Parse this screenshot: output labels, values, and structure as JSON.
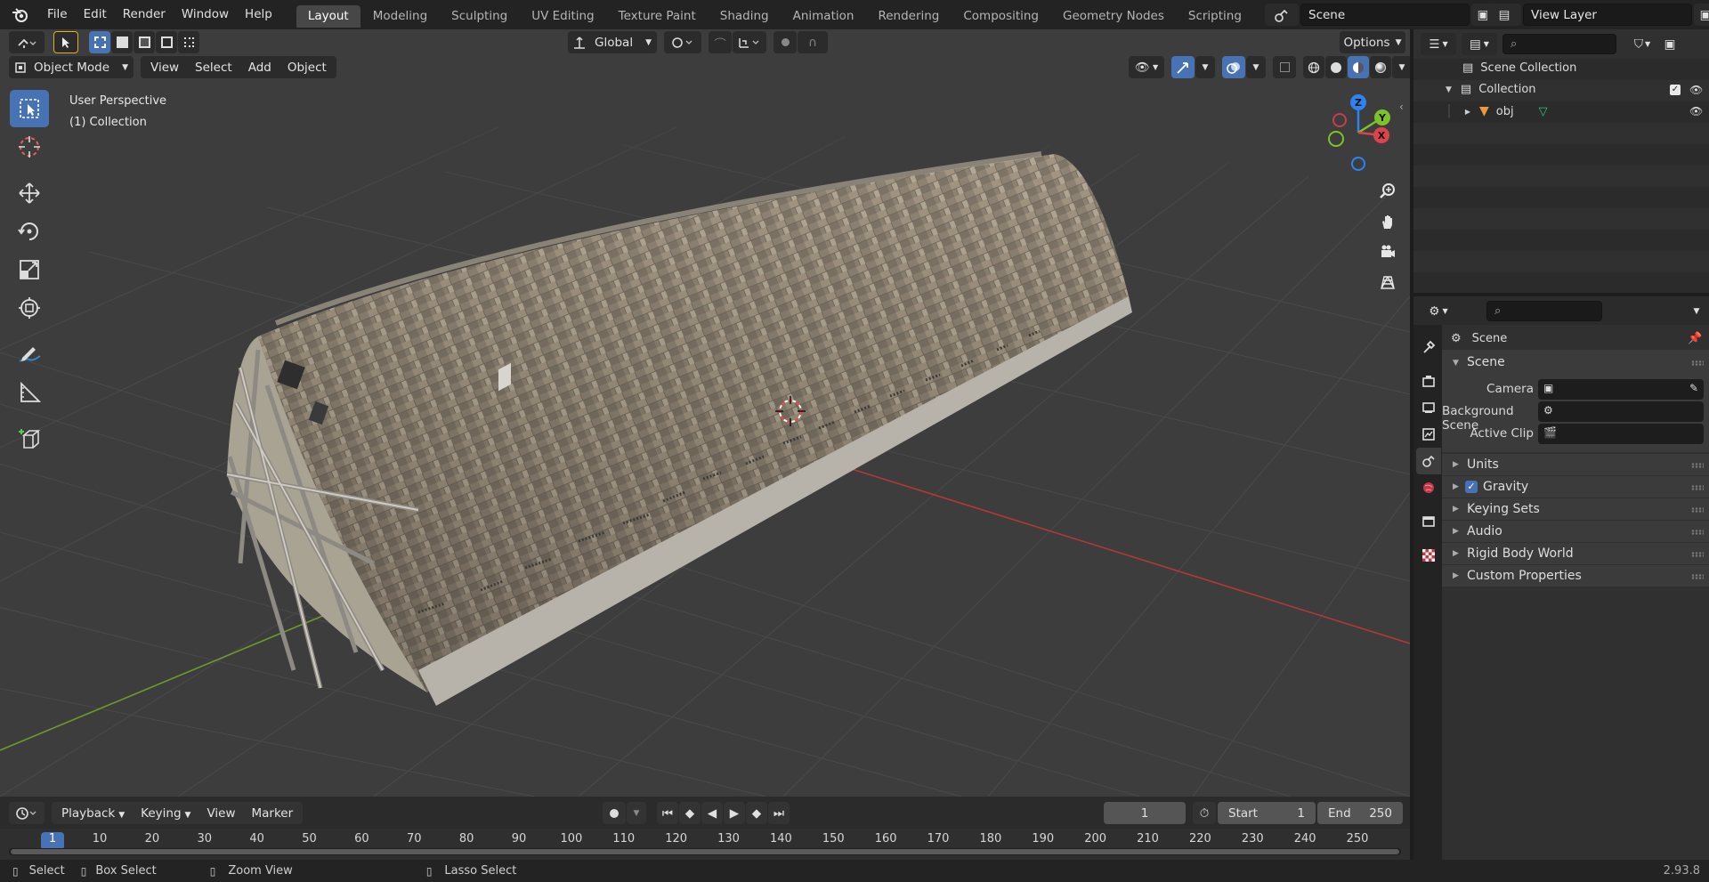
{
  "topbar": {
    "menus": [
      "File",
      "Edit",
      "Render",
      "Window",
      "Help"
    ],
    "workspaces": [
      "Layout",
      "Modeling",
      "Sculpting",
      "UV Editing",
      "Texture Paint",
      "Shading",
      "Animation",
      "Rendering",
      "Compositing",
      "Geometry Nodes",
      "Scripting"
    ],
    "active_workspace": "Layout",
    "scene_name": "Scene",
    "view_layer": "View Layer"
  },
  "viewport": {
    "mode": "Object Mode",
    "menus": [
      "View",
      "Select",
      "Add",
      "Object"
    ],
    "transform_orientation": "Global",
    "options_label": "Options",
    "overlay_line1": "User Perspective",
    "overlay_line2": "(1) Collection",
    "axis_colors": {
      "x": "#e0424b",
      "y": "#7ec22a",
      "z": "#2e83f0"
    }
  },
  "outliner": {
    "root": "Scene Collection",
    "collection": "Collection",
    "object": "obj"
  },
  "properties": {
    "context_title": "Scene",
    "panel_title": "Scene",
    "camera_label": "Camera",
    "background_scene_label": "Background Scene",
    "active_clip_label": "Active Clip",
    "panels": [
      "Units",
      "Gravity",
      "Keying Sets",
      "Audio",
      "Rigid Body World",
      "Custom Properties"
    ]
  },
  "timeline": {
    "menus": [
      "Playback",
      "Keying",
      "View",
      "Marker"
    ],
    "current_frame": "1",
    "start_label": "Start",
    "start_value": "1",
    "end_label": "End",
    "end_value": "250",
    "ruler": [
      "1",
      "10",
      "20",
      "30",
      "40",
      "50",
      "60",
      "70",
      "80",
      "90",
      "100",
      "110",
      "120",
      "130",
      "140",
      "150",
      "160",
      "170",
      "180",
      "190",
      "200",
      "210",
      "220",
      "230",
      "240",
      "250"
    ]
  },
  "statusbar": {
    "select": "Select",
    "box_select": "Box Select",
    "zoom_view": "Zoom View",
    "lasso_select": "Lasso Select",
    "version": "2.93.8"
  }
}
